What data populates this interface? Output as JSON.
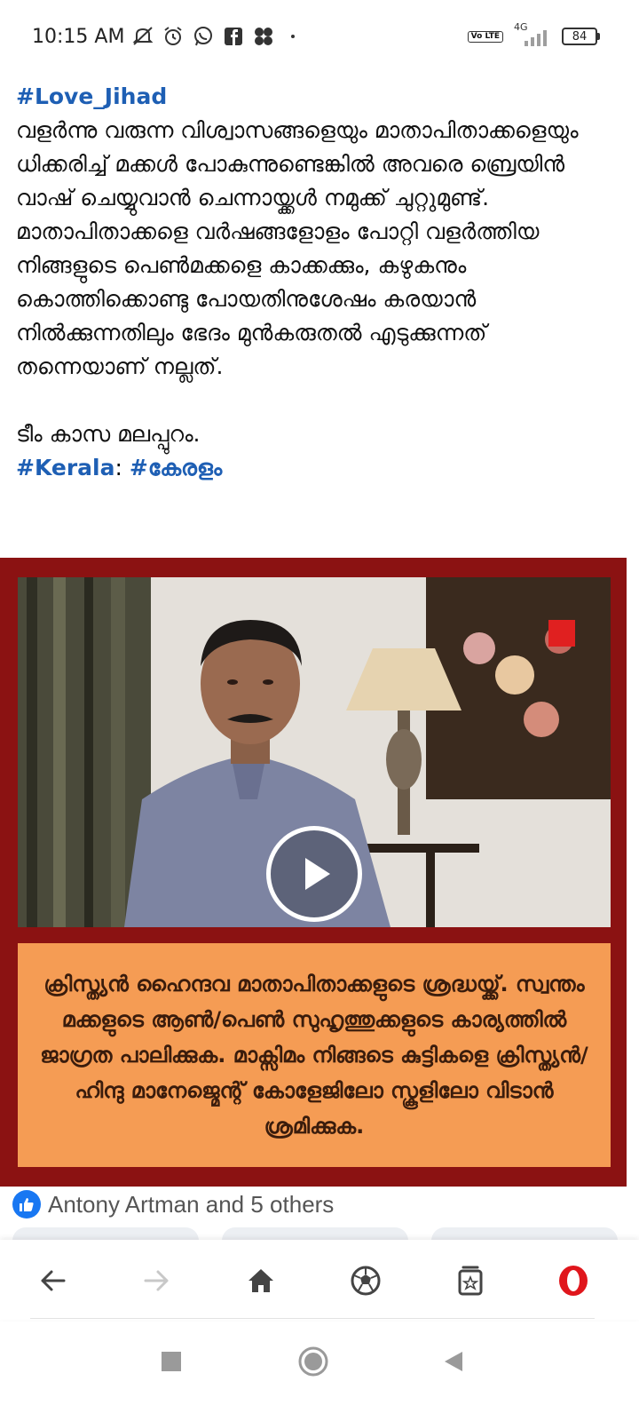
{
  "status_bar": {
    "time": "10:15 AM",
    "left_icons": [
      "mute-icon",
      "alarm-icon",
      "whatsapp-icon",
      "facebook-icon",
      "app-icon"
    ],
    "network_label": "4G",
    "volte_label": "Vo LTE",
    "battery": "84"
  },
  "post": {
    "hashtag_top": "#Love_Jihad",
    "body": "വളർന്നു വരുന്ന വിശ്വാസങ്ങളെയും മാതാപിതാക്കളെയും ധിക്കരിച്ച് മക്കൾ പോകുന്നുണ്ടെങ്കിൽ അവരെ ബ്രെയിൻ വാഷ് ചെയ്യുവാൻ ചെന്നായ്ക്കൾ  നമുക്ക് ചുറ്റുമുണ്ട്. മാതാപിതാക്കളെ വർഷങ്ങളോളം പോറ്റി വളർത്തിയ നിങ്ങളുടെ പെൺമക്കളെ കാക്കക്കും, കഴുകനും കൊത്തിക്കൊണ്ടു പോയതിനുശേഷം കരയാൻ നിൽക്കുന്നതിലും ഭേദം മുൻകരുതൽ എടുക്കുന്നത് തന്നെയാണ് നല്ലത്.",
    "signature": "ടീം കാസ മലപ്പുറം.",
    "tag_kerala": "#Kerala",
    "tag_separator": ":",
    "tag_keralam": "#കേരളം"
  },
  "media": {
    "play_label": "play-icon",
    "caption": "ക്രിസ്ത്യൻ ഹൈന്ദവ മാതാപിതാക്കളുടെ ശ്രദ്ധയ്ക്ക്.  സ്വന്തം മക്കളുടെ ആൺ/പെൺ സുഹൃത്തുക്കളുടെ കാര്യത്തിൽ ജാഗ്രത പാലിക്കുക. മാക്സിമം നിങ്ങടെ കുട്ടികളെ ക്രിസ്ത്യൻ/ ഹിന്ദു മാനേജ്മെന്റ് കോളേജിലോ സ്കൂളിലോ  വിടാൻ ശ്രമിക്കുക.",
    "frame_color": "#8b1212",
    "caption_bg": "#f59c54"
  },
  "reactions": {
    "text": "Antony Artman and 5 others"
  },
  "browser_bar": {
    "buttons": [
      "back-icon",
      "forward-icon",
      "home-icon",
      "football-icon",
      "tabs-icon",
      "opera-icon"
    ]
  },
  "colors": {
    "hashtag": "#1e5fb4",
    "like": "#1877f2",
    "opera": "#e0161c"
  }
}
